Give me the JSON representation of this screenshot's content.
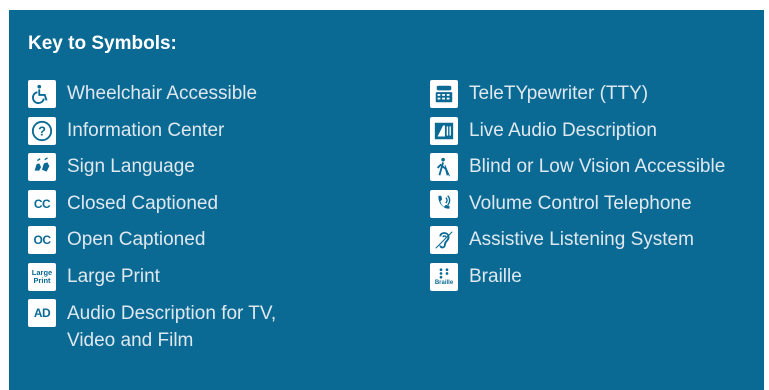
{
  "title": "Key to Symbols:",
  "left_items": [
    {
      "icon": "wheelchair-icon",
      "label": "Wheelchair Accessible"
    },
    {
      "icon": "information-icon",
      "label": "Information Center"
    },
    {
      "icon": "sign-language-icon",
      "label": "Sign Language"
    },
    {
      "icon": "closed-captioned-icon",
      "label": "Closed Captioned",
      "icon_text": "CC"
    },
    {
      "icon": "open-captioned-icon",
      "label": "Open Captioned",
      "icon_text": "OC"
    },
    {
      "icon": "large-print-icon",
      "label": "Large Print",
      "icon_text": "Large Print"
    },
    {
      "icon": "audio-description-icon",
      "label": "Audio Description for TV, Video and Film",
      "icon_text": "AD"
    }
  ],
  "right_items": [
    {
      "icon": "tty-icon",
      "label": "TeleTYpewriter (TTY)"
    },
    {
      "icon": "live-audio-description-icon",
      "label": "Live Audio Description"
    },
    {
      "icon": "blind-low-vision-icon",
      "label": "Blind or Low Vision Accessible"
    },
    {
      "icon": "volume-control-telephone-icon",
      "label": "Volume Control Telephone"
    },
    {
      "icon": "assistive-listening-icon",
      "label": "Assistive Listening System"
    },
    {
      "icon": "braille-icon",
      "label": "Braille",
      "icon_text": "Braille"
    }
  ],
  "colors": {
    "panel": "#0a6a94",
    "text": "#dfe8ef",
    "icon_bg": "#ffffff"
  }
}
